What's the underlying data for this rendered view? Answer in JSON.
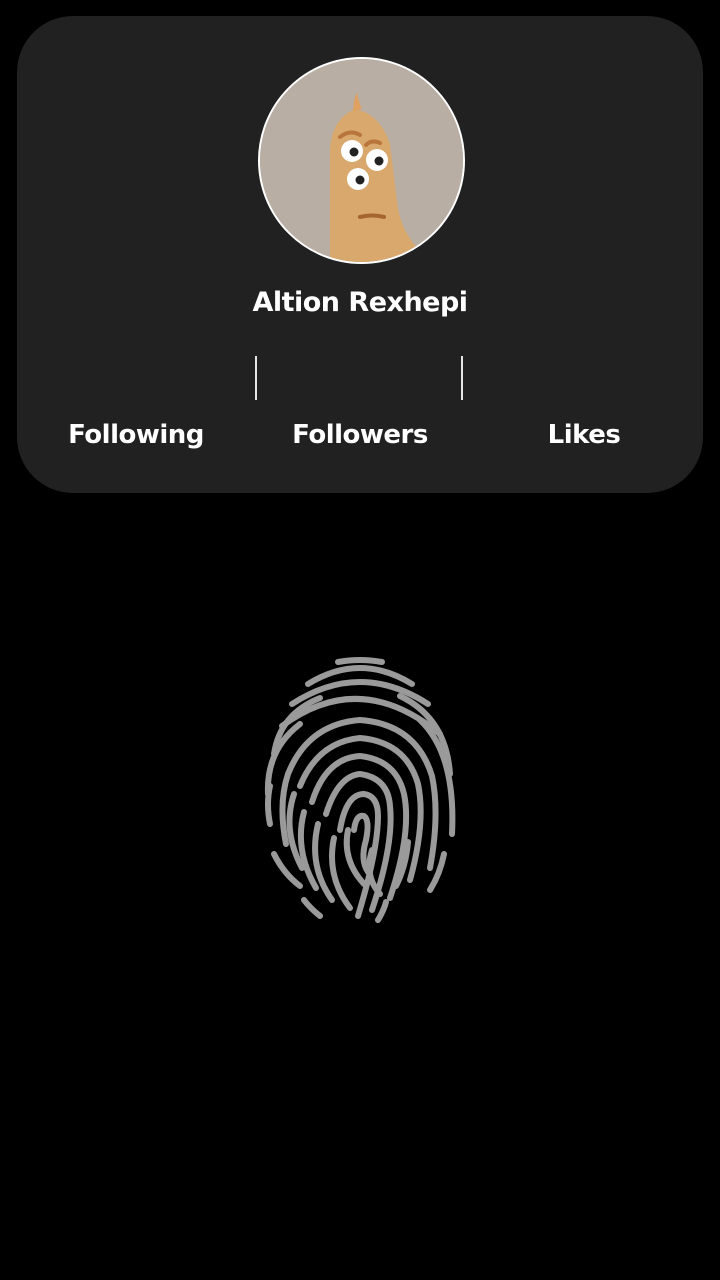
{
  "profile": {
    "username": "Altion Rexhepi",
    "stats": [
      {
        "label": "Following"
      },
      {
        "label": "Followers"
      },
      {
        "label": "Likes"
      }
    ]
  },
  "icons": {
    "avatar": "cartoon-character-avatar",
    "unlock": "fingerprint-icon"
  },
  "colors": {
    "background": "#000000",
    "card": "#212121",
    "text": "#ffffff",
    "fingerprint": "#9a9a9a"
  }
}
